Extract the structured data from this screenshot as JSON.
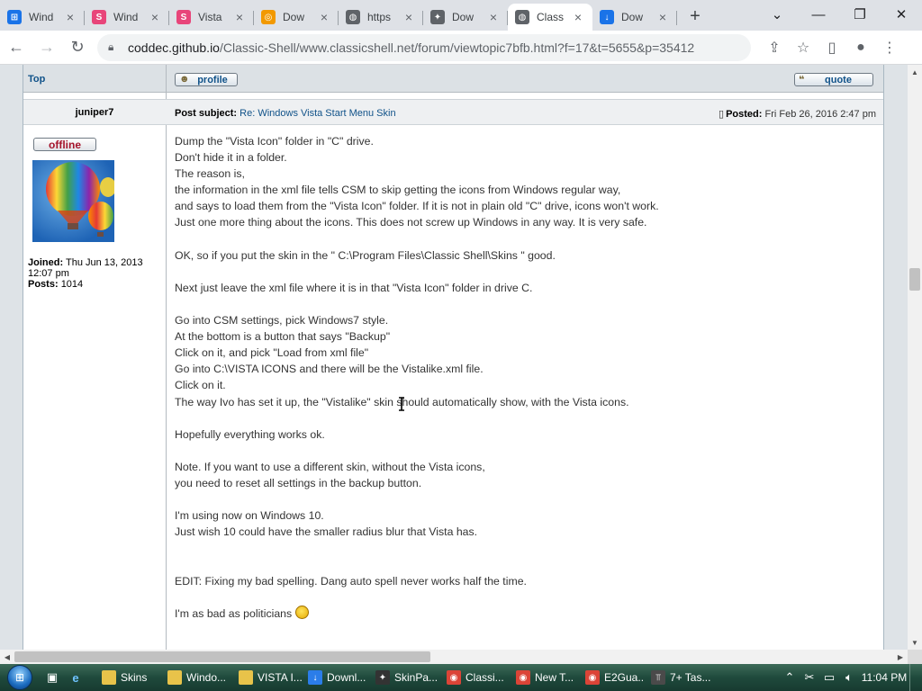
{
  "browser": {
    "tabs": [
      {
        "title": "Wind",
        "icon": "windows-logo-icon",
        "color": "#1a73e8",
        "glyph": "⊞",
        "active": false
      },
      {
        "title": "Wind",
        "icon": "sp-logo-icon",
        "color": "#e8457a",
        "glyph": "S",
        "active": false
      },
      {
        "title": "Vista",
        "icon": "sp-logo-icon",
        "color": "#e8457a",
        "glyph": "S",
        "active": false
      },
      {
        "title": "Dow",
        "icon": "swirl-icon",
        "color": "#f29900",
        "glyph": "◎",
        "active": false
      },
      {
        "title": "https",
        "icon": "globe-icon",
        "color": "#5f6368",
        "glyph": "◍",
        "active": false
      },
      {
        "title": "Dow",
        "icon": "puzzle-icon",
        "color": "#5f6368",
        "glyph": "✦",
        "active": false
      },
      {
        "title": "Class",
        "icon": "globe-icon",
        "color": "#5f6368",
        "glyph": "◍",
        "active": true
      },
      {
        "title": "Dow",
        "icon": "download-icon",
        "color": "#1a73e8",
        "glyph": "↓",
        "active": false
      }
    ],
    "url_host": "coddec.github.io",
    "url_path": "/Classic-Shell/www.classicshell.net/forum/viewtopic7bfb.html?f=17&t=5655&p=35412"
  },
  "forum": {
    "top_link": "Top",
    "profile_button": "profile",
    "quote_button": "quote",
    "author": "juniper7",
    "subject_label": "Post subject:",
    "subject_text": "Re: Windows Vista Start Menu Skin",
    "posted_label": "Posted:",
    "posted_date": "Fri Feb 26, 2016 2:47 pm",
    "status": "offline",
    "joined_label": "Joined:",
    "joined_value_1": "Thu Jun 13, 2013",
    "joined_value_2": "12:07 pm",
    "posts_label": "Posts:",
    "posts_value": "1014",
    "body_lines": [
      "Dump the \"Vista Icon\" folder in \"C\" drive.",
      "Don't hide it in a folder.",
      "The reason is,",
      "the information in the xml file tells CSM to skip getting the icons from Windows regular way,",
      "and says to load them from the \"Vista Icon\" folder. If it is not in plain old \"C\" drive, icons won't work.",
      "Just one more thing about the icons. This does not screw up Windows in any way. It is very safe.",
      "",
      "OK, so if you put the skin in the \" C:\\Program Files\\Classic Shell\\Skins \" good.",
      "",
      "Next just leave the xml file where it is in that \"Vista Icon\" folder in drive C.",
      "",
      "Go into CSM settings, pick Windows7 style.",
      "At the bottom is a button that says \"Backup\"",
      "Click on it, and pick \"Load from xml file\"",
      "Go into C:\\VISTA ICONS and there will be the Vistalike.xml file.",
      "Click on it.",
      "The way Ivo has set it up, the \"Vistalike\" skin should automatically show, with the Vista icons.",
      "",
      "Hopefully everything works ok.",
      "",
      "Note. If you want to use a different skin, without the Vista icons,",
      "you need to reset all settings in the backup button.",
      "",
      "I'm using now on Windows 10.",
      "Just wish 10 could have the smaller radius blur that Vista has.",
      "",
      "",
      "EDIT: Fixing my bad spelling. Dang auto spell never works half the time.",
      "",
      "I'm as bad as politicians"
    ]
  },
  "taskbar": {
    "items": [
      {
        "label": "Skins",
        "icon": "folder-icon",
        "color": "#e8c34a",
        "glyph": "",
        "width": 70
      },
      {
        "label": "Windo...",
        "icon": "folder-icon",
        "color": "#e8c34a",
        "glyph": "",
        "width": 76
      },
      {
        "label": "VISTA I...",
        "icon": "folder-icon",
        "color": "#e8c34a",
        "glyph": "",
        "width": 74
      },
      {
        "label": "Downl...",
        "icon": "download-icon",
        "color": "#2b7de9",
        "glyph": "↓",
        "width": 72
      },
      {
        "label": "SkinPa...",
        "icon": "skinpack-icon",
        "color": "#333333",
        "glyph": "✦",
        "width": 76
      },
      {
        "label": "Classi...",
        "icon": "chrome-icon",
        "color": "#db4437",
        "glyph": "◉",
        "width": 74
      },
      {
        "label": "New T...",
        "icon": "chrome-icon",
        "color": "#db4437",
        "glyph": "◉",
        "width": 74
      },
      {
        "label": "E2Gua...",
        "icon": "chrome-icon",
        "color": "#db4437",
        "glyph": "◉",
        "width": 70
      },
      {
        "label": "7+ Tas...",
        "icon": "taskbar-tweaker-icon",
        "color": "#4a4a4a",
        "glyph": "⫪",
        "width": 72
      }
    ],
    "clock": "11:04 PM"
  }
}
